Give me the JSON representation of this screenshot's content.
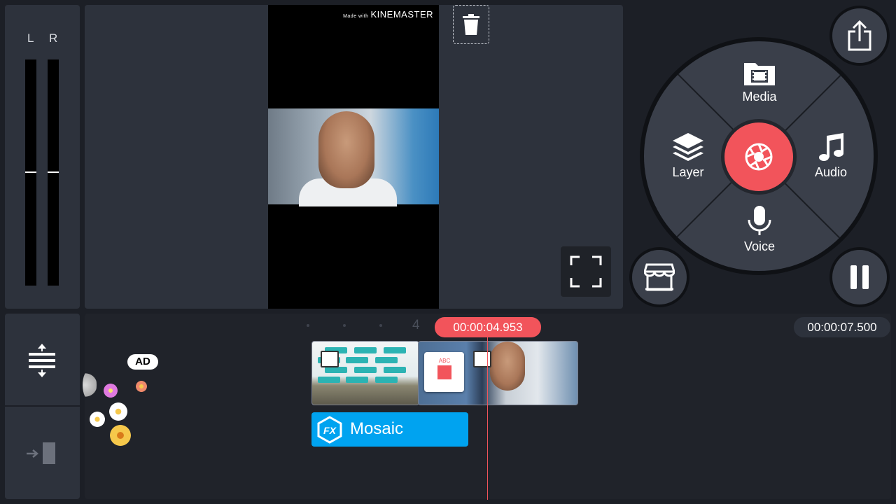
{
  "audio_meter": {
    "left_label": "L",
    "right_label": "R"
  },
  "preview": {
    "watermark_prefix": "Made with",
    "watermark_brand": "KINEMASTER"
  },
  "menu": {
    "media_label": "Media",
    "layer_label": "Layer",
    "audio_label": "Audio",
    "voice_label": "Voice"
  },
  "timeline": {
    "current_time": "00:00:04.953",
    "total_time": "00:00:07.500",
    "ruler_mark": "4",
    "fx_clip_label": "Mosaic",
    "ad_badge": "AD",
    "transition_text": "ABC"
  },
  "icons": [
    "trash-icon",
    "fullscreen-icon",
    "media-icon",
    "layer-icon",
    "audio-icon",
    "voice-icon",
    "capture-icon",
    "share-icon",
    "store-icon",
    "pause-icon",
    "timeline-expand-icon",
    "timeline-collapse-icon",
    "fx-icon",
    "image-icon"
  ],
  "colors": {
    "accent": "#f2545b",
    "fx_clip": "#00a3f0",
    "panel": "#2d323c",
    "background": "#1c1f26"
  }
}
